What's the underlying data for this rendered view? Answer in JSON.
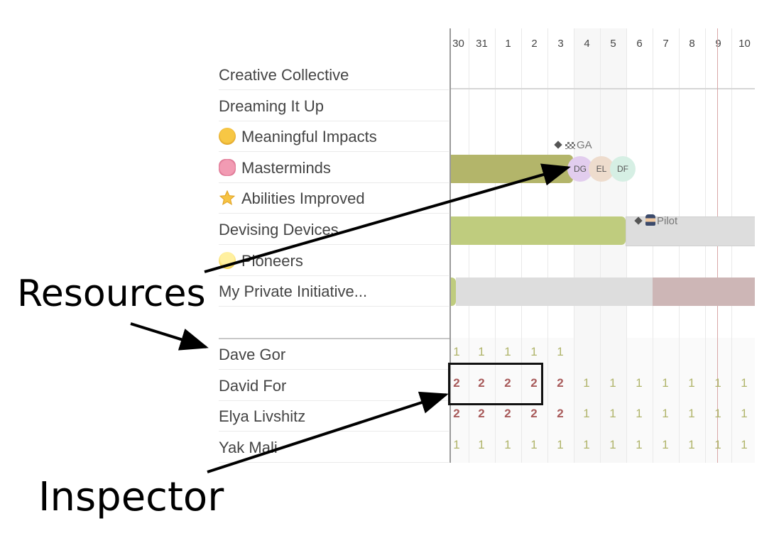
{
  "timeline": {
    "days": [
      "30",
      "31",
      "1",
      "2",
      "3",
      "4",
      "5",
      "6",
      "7",
      "8",
      "9",
      "10"
    ]
  },
  "rows": [
    {
      "label": "Creative Collective",
      "icon": ""
    },
    {
      "label": "Dreaming It Up",
      "icon": ""
    },
    {
      "label": "Meaningful Impacts",
      "icon": "nerd-face-icon"
    },
    {
      "label": "Masterminds",
      "icon": "brain-icon"
    },
    {
      "label": "Abilities Improved",
      "icon": "star-icon"
    },
    {
      "label": "Devising Devices",
      "icon": ""
    },
    {
      "label": "Pioneers",
      "icon": "lightbulb-icon"
    },
    {
      "label": "My Private Initiative...",
      "icon": ""
    }
  ],
  "milestones": {
    "ga": "GA",
    "pilot": "Pilot"
  },
  "avatars": [
    "DG",
    "EL",
    "DF"
  ],
  "resources": [
    {
      "name": "Dave Gor",
      "values": [
        "1",
        "1",
        "1",
        "1",
        "1"
      ]
    },
    {
      "name": "David For",
      "values": [
        "2",
        "2",
        "2",
        "2",
        "2",
        "1",
        "1",
        "1",
        "1",
        "1",
        "1",
        "1"
      ]
    },
    {
      "name": "Elya Livshitz",
      "values": [
        "2",
        "2",
        "2",
        "2",
        "2",
        "1",
        "1",
        "1",
        "1",
        "1",
        "1",
        "1"
      ]
    },
    {
      "name": "Yak Mali",
      "values": [
        "1",
        "1",
        "1",
        "1",
        "1",
        "1",
        "1",
        "1",
        "1",
        "1",
        "1",
        "1"
      ]
    }
  ],
  "annotations": {
    "resources": "Resources",
    "inspector": "Inspector"
  },
  "colors": {
    "bar_olive": "#b3b56a",
    "bar_light_olive": "#bfcc7e",
    "load_one": "#b0b46a",
    "load_two": "#a85a5a"
  }
}
